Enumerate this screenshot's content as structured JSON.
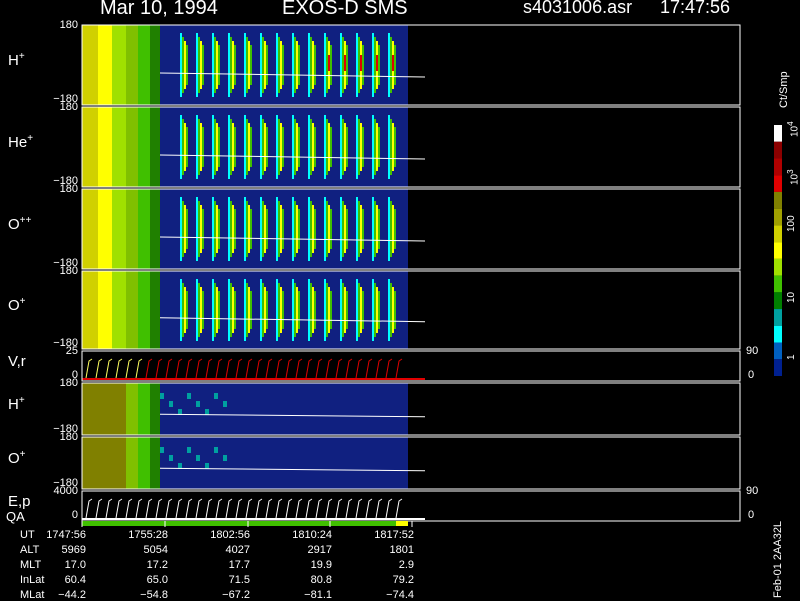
{
  "header": {
    "date": "Mar 10, 1994",
    "instrument": "EXOS-D SMS",
    "file": "s4031006.asr",
    "time": "17:47:56"
  },
  "panels": [
    {
      "label": "H",
      "sup": "+",
      "ytop": "180",
      "ybot": "−180"
    },
    {
      "label": "He",
      "sup": "+",
      "ytop": "180",
      "ybot": "−180"
    },
    {
      "label": "O",
      "sup": "++",
      "ytop": "180",
      "ybot": "−180"
    },
    {
      "label": "O",
      "sup": "+",
      "ytop": "180",
      "ybot": "−180"
    },
    {
      "label": "V,r",
      "sup": "",
      "ytop": "25",
      "ybot": "0",
      "rtop": "90",
      "rbot": "0"
    },
    {
      "label": "H",
      "sup": "+",
      "ytop": "180",
      "ybot": "−180"
    },
    {
      "label": "O",
      "sup": "+",
      "ytop": "180",
      "ybot": "−180"
    },
    {
      "label": "E,p",
      "sup": "",
      "ytop": "4000",
      "ybot": "0",
      "rtop": "90",
      "rbot": "0"
    }
  ],
  "qa_label": "QA",
  "colorbar": {
    "unit": "Ct/Smp",
    "labels": [
      "10",
      "4",
      "10",
      "3",
      "100",
      "10",
      "1"
    ],
    "colors": [
      "#ffffff",
      "#8b0000",
      "#b00000",
      "#e00000",
      "#808000",
      "#a0a000",
      "#d0d000",
      "#ffff00",
      "#a0e000",
      "#40c000",
      "#008000",
      "#00a0a0",
      "#00ffff",
      "#0060c0",
      "#002090"
    ]
  },
  "side_text": "Feb-01 2AA32L",
  "ephemeris": {
    "rows": [
      {
        "name": "UT",
        "values": [
          "1747:56",
          "1755:28",
          "1802:56",
          "1810:24",
          "1817:52"
        ]
      },
      {
        "name": "ALT",
        "values": [
          "5969",
          "5054",
          "4027",
          "2917",
          "1801"
        ]
      },
      {
        "name": "MLT",
        "values": [
          "17.0",
          "17.2",
          "17.7",
          "19.9",
          "2.9"
        ]
      },
      {
        "name": "InLat",
        "values": [
          "60.4",
          "65.0",
          "71.5",
          "80.8",
          "79.2"
        ]
      },
      {
        "name": "MLat",
        "values": [
          "−44.2",
          "−54.8",
          "−67.2",
          "−81.1",
          "−74.4"
        ]
      }
    ]
  },
  "chart_data": {
    "type": "heatmap",
    "x_tick_labels": [
      "1747:56",
      "1755:28",
      "1802:56",
      "1810:24",
      "1817:52"
    ],
    "panels": [
      "H+",
      "He+",
      "O++",
      "O+",
      "V,r",
      "H+",
      "O+",
      "E,p"
    ],
    "y_range_angle": [
      -180,
      180
    ],
    "color_scale": "log",
    "color_range": [
      1,
      10000
    ],
    "series": [
      {
        "values": [
          0,
          0,
          0,
          0
        ]
      }
    ]
  }
}
